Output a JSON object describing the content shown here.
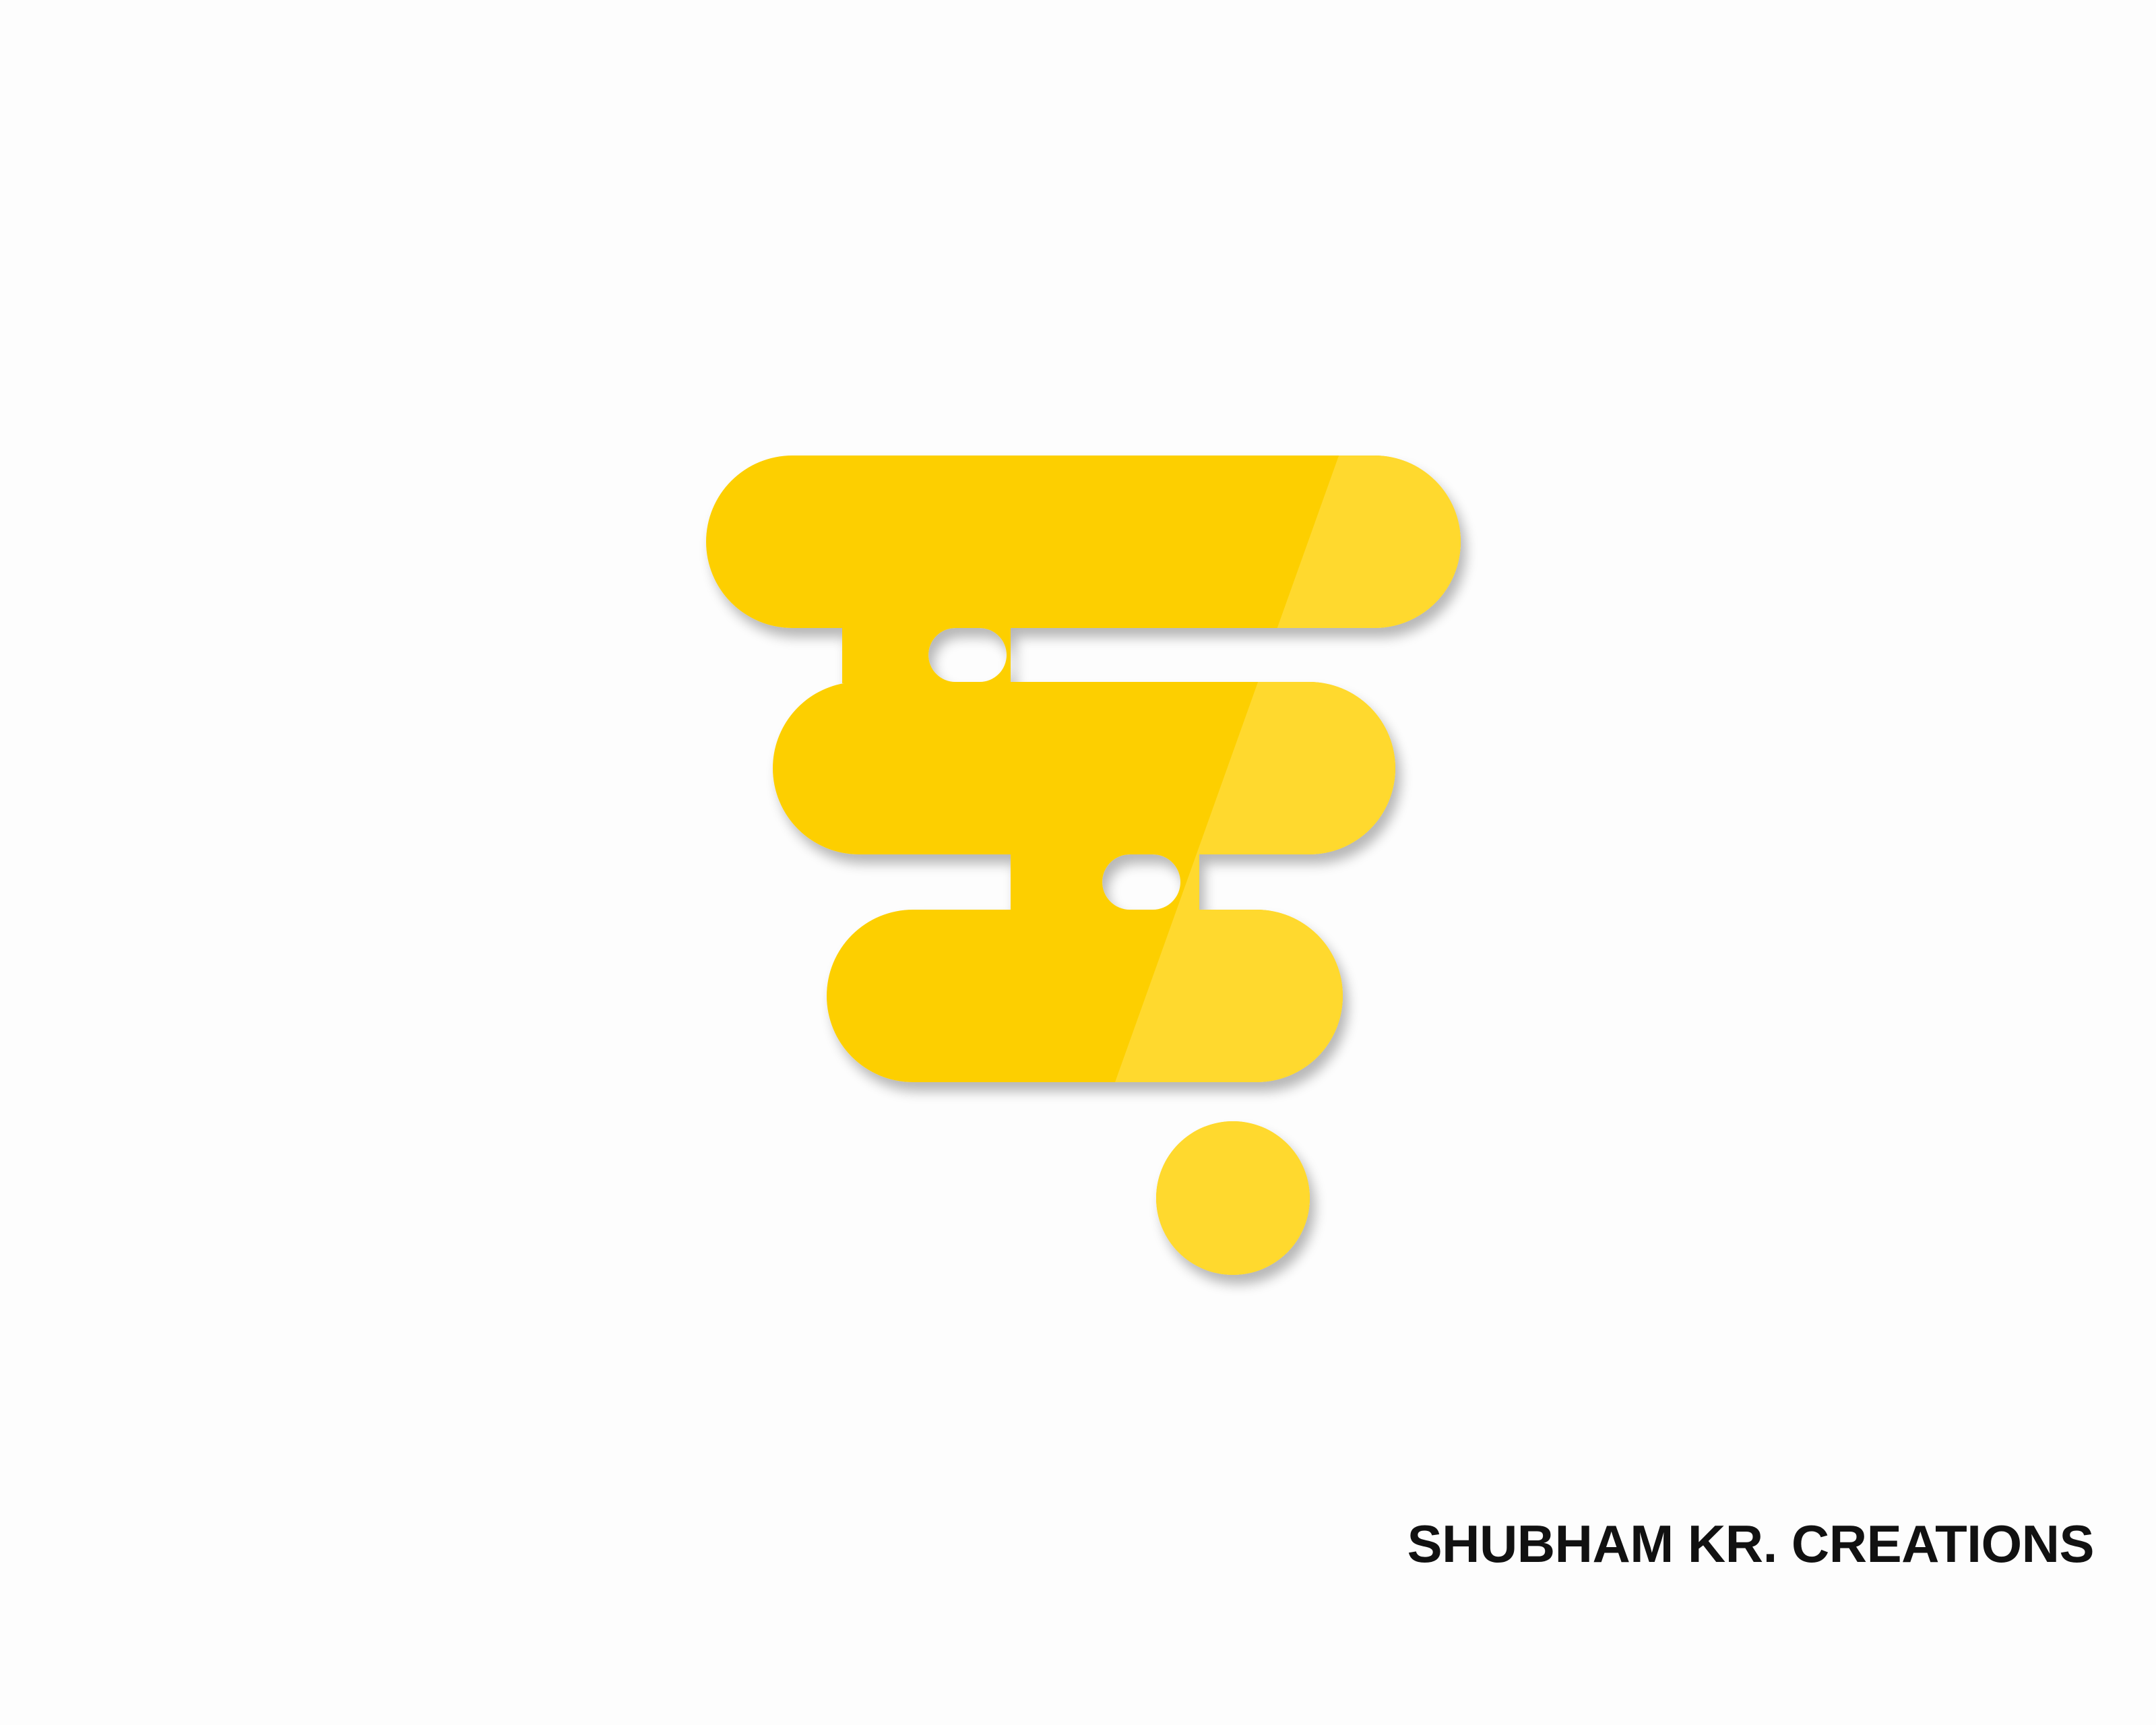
{
  "logo": {
    "icon": "stacked-pills-with-dot-logo",
    "colors": {
      "primary": "#fdcf05",
      "highlight": "#ffd92f",
      "background": "#fdfdfd"
    }
  },
  "footer": {
    "credit": "SHUBHAM KR. CREATIONS"
  }
}
